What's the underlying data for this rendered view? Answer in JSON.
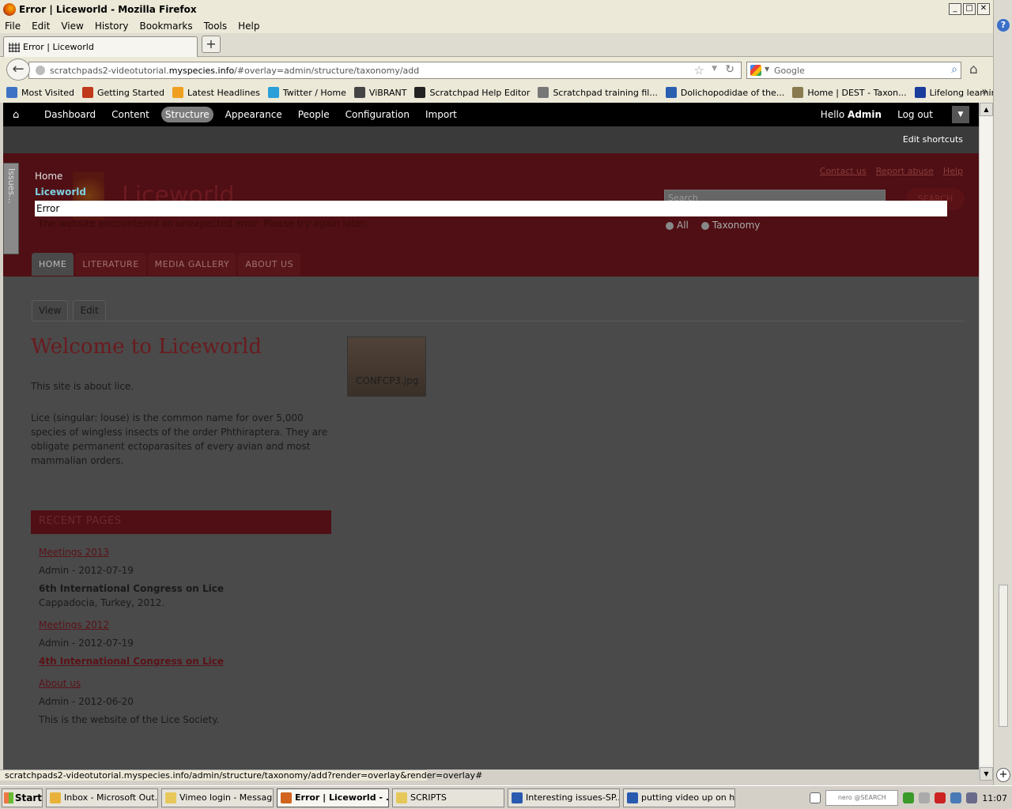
{
  "window": {
    "title": "Error | Liceworld - Mozilla Firefox"
  },
  "menu": [
    "File",
    "Edit",
    "View",
    "History",
    "Bookmarks",
    "Tools",
    "Help"
  ],
  "tab": {
    "label": "Error | Liceworld"
  },
  "url": {
    "prefix": "scratchpads2-videotutorial.",
    "host": "myspecies.info",
    "path": "/#overlay=admin/structure/taxonomy/add"
  },
  "search": {
    "placeholder": "Google"
  },
  "bookmarks": [
    {
      "label": "Most Visited",
      "color": "#3d72c4"
    },
    {
      "label": "Getting Started",
      "color": "#c0391b"
    },
    {
      "label": "Latest Headlines",
      "color": "#f0a020"
    },
    {
      "label": "Twitter / Home",
      "color": "#2a9fd8"
    },
    {
      "label": "ViBRANT",
      "color": "#444444"
    },
    {
      "label": "Scratchpad Help Editor",
      "color": "#222222"
    },
    {
      "label": "Scratchpad training fil...",
      "color": "#777777"
    },
    {
      "label": "Dolichopodidae of the...",
      "color": "#2a5fb0"
    },
    {
      "label": "Home | DEST - Taxon...",
      "color": "#8a7a50"
    },
    {
      "label": "Lifelong learning - Fu...",
      "color": "#1a3c9c"
    }
  ],
  "toolbar": {
    "items": [
      "Dashboard",
      "Content",
      "Structure",
      "Appearance",
      "People",
      "Configuration",
      "Import"
    ],
    "active": "Structure",
    "hello": "Hello",
    "user": "Admin",
    "logout": "Log out",
    "edit_shortcuts": "Edit shortcuts"
  },
  "header": {
    "links": [
      "Contact us",
      "Report abuse",
      "Help"
    ],
    "breadcrumb": "Home",
    "site_name": "Liceworld",
    "big_name": "Liceworld",
    "search_placeholder": "Search",
    "search_button": "SEARCH",
    "radio_all": "All",
    "radio_taxonomy": "Taxonomy",
    "issues_tab": "Issues..."
  },
  "error": {
    "title": "Error",
    "message": "The website encountered an unexpected error. Please try again later."
  },
  "primary_nav": [
    "HOME",
    "LITERATURE",
    "MEDIA GALLERY",
    "ABOUT US"
  ],
  "local_tabs": [
    "View",
    "Edit"
  ],
  "main": {
    "heading": "Welcome to Liceworld",
    "intro": "This site is about lice.",
    "body": "Lice (singular: louse) is the common name for over 5,000 species of wingless insects of the order Phthiraptera. They are obligate permanent ectoparasites of every avian and most mammalian orders.",
    "image_caption": "CONFCP3.jpg"
  },
  "recent": {
    "title": "RECENT PAGES",
    "items": [
      {
        "text": "Meetings 2013"
      },
      {
        "text": "Admin - 2012-07-19"
      },
      {
        "text": "6th International Congress on Lice"
      },
      {
        "text": "Cappadocia, Turkey, 2012."
      },
      {
        "text": "Meetings 2012"
      },
      {
        "text": "Admin - 2012-07-19"
      },
      {
        "text": "4th International Congress on Lice"
      },
      {
        "text": "About us"
      },
      {
        "text": "Admin - 2012-06-20"
      },
      {
        "text": "This is the website of the Lice Society."
      }
    ]
  },
  "status": "scratchpads2-videotutorial.myspecies.info/admin/structure/taxonomy/add?render=overlay&render=overlay#",
  "taskbar": {
    "start": "Start",
    "items": [
      {
        "label": "Inbox - Microsoft Out...",
        "color": "#e8b23a"
      },
      {
        "label": "Vimeo login - Messag...",
        "color": "#e8c85a"
      },
      {
        "label": "Error | Liceworld - ...",
        "color": "#d2641e"
      },
      {
        "label": "SCRIPTS",
        "color": "#e6c85a"
      },
      {
        "label": "Interesting issues-SP...",
        "color": "#2a5ab0"
      },
      {
        "label": "putting video up on h...",
        "color": "#2a5ab0"
      }
    ],
    "nero": "nero @SEARCH",
    "clock": "11:07"
  }
}
